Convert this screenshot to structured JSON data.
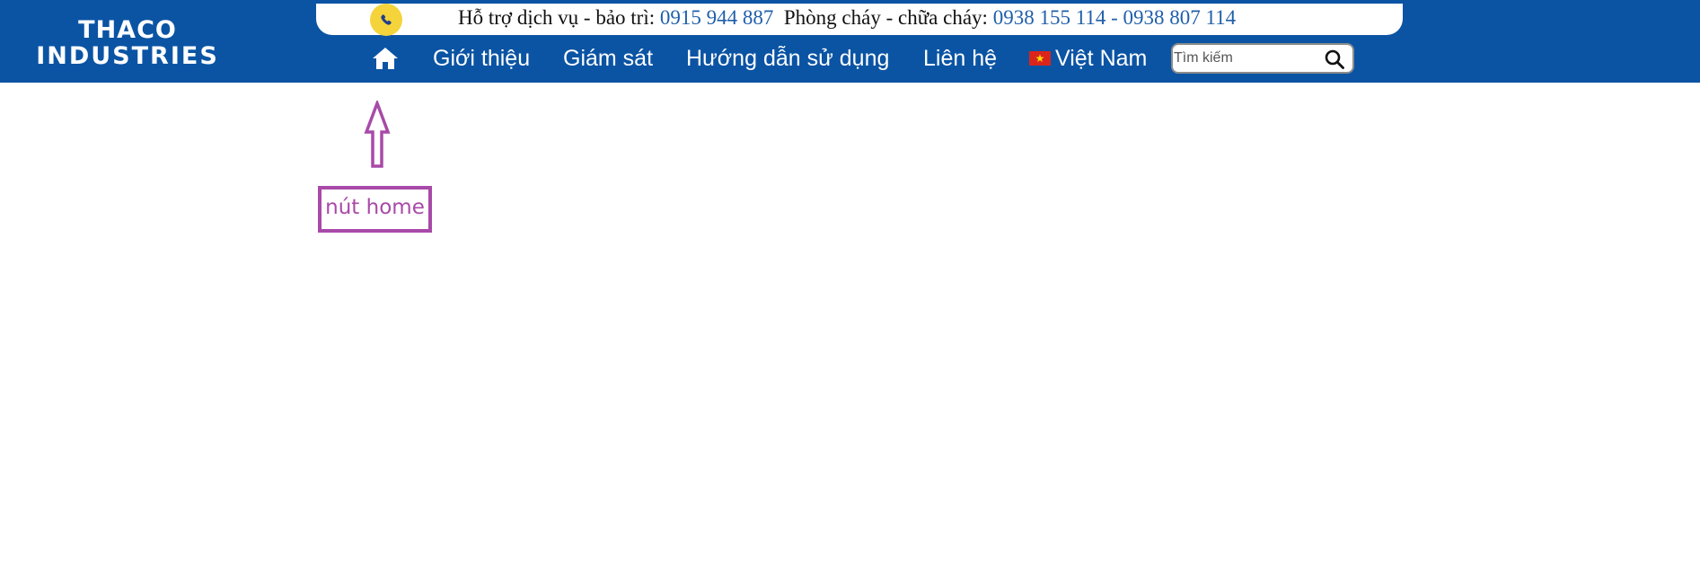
{
  "header": {
    "logo_line1": "THACO",
    "logo_line2": "INDUSTRIES",
    "bg_color": "#0b54a4"
  },
  "support": {
    "maintenance_label": "Hỗ trợ dịch vụ - bảo trì:",
    "maintenance_phone": "0915 944 887",
    "fire_label": "Phòng cháy - chữa cháy:",
    "fire_phones": "0938 155 114 - 0938 807 114",
    "phone_icon": "phone-icon",
    "badge_color": "#f5d33a"
  },
  "nav": {
    "home_icon": "home-icon",
    "items": [
      {
        "label": "Giới thiệu"
      },
      {
        "label": "Giám sát"
      },
      {
        "label": "Hướng dẫn sử dụng"
      },
      {
        "label": "Liên hệ"
      }
    ],
    "language": {
      "label": "Việt Nam",
      "flag_icon": "vietnam-flag-icon"
    }
  },
  "search": {
    "placeholder": "Tìm kiếm",
    "icon": "search-icon"
  },
  "annotation": {
    "label": "nút home",
    "color": "#a84aa8"
  }
}
